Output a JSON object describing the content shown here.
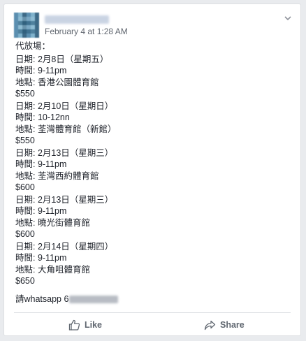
{
  "post": {
    "timestamp": "February 4 at 1:28 AM",
    "intro": "代放場：",
    "events": [
      {
        "date": "日期: 2月8日（星期五）",
        "time": "時間: 9-11pm",
        "venue": "地點: 香港公園體育館",
        "price": "$550"
      },
      {
        "date": "日期: 2月10日（星期日）",
        "time": "時間: 10-12nn",
        "venue": "地點: 荃灣體育館（新館）",
        "price": "$550"
      },
      {
        "date": "日期: 2月13日（星期三）",
        "time": "時間: 9-11pm",
        "venue": "地點: 荃灣西約體育館",
        "price": "$600"
      },
      {
        "date": "日期: 2月13日（星期三）",
        "time": "時間: 9-11pm",
        "venue": "地點: 曉光街體育館",
        "price": "$600"
      },
      {
        "date": "日期: 2月14日（星期四）",
        "time": "時間: 9-11pm",
        "venue": "地點: 大角咀體育館",
        "price": "$650"
      }
    ],
    "contact_prefix": "請whatsapp 6"
  },
  "actions": {
    "like_label": "Like",
    "share_label": "Share"
  },
  "icons": {
    "menu": "chevron-down-icon",
    "like": "thumbs-up-icon",
    "share": "share-arrow-icon"
  },
  "colors": {
    "background": "#e9ebee",
    "card": "#ffffff",
    "text": "#1d2129",
    "muted": "#616770"
  }
}
